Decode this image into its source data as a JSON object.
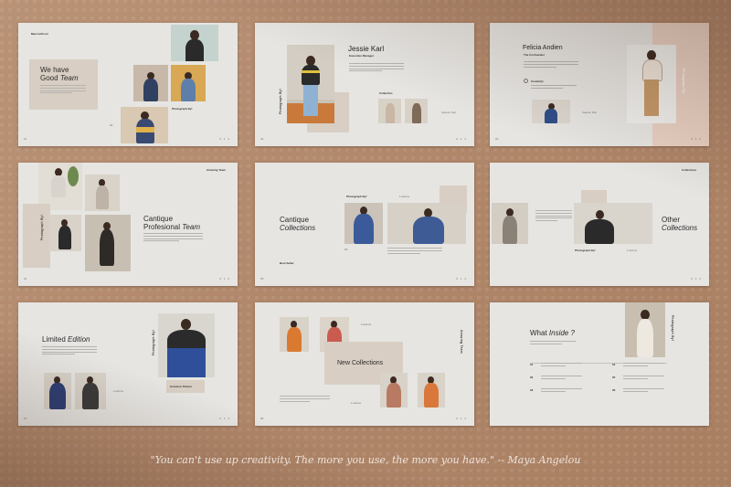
{
  "quote": "\"You can't use up creativity. The more you use, the more you have.\" -- Maya Angelou",
  "slides": {
    "s1": {
      "tag": "Meet with us!",
      "title_a": "We have",
      "title_b": "Good",
      "title_c": "Team",
      "caption": "Photograph By!",
      "num": "01",
      "page": "0 1 2"
    },
    "s2": {
      "name": "Jessie Karl",
      "role": "Executive Manager",
      "side": "Photograph By!",
      "sub": "Collection",
      "small": "Jessie Kal",
      "num": "02",
      "page": "0 1 2"
    },
    "s3": {
      "name": "Felicia Andien",
      "role": "The Cocfounder",
      "item": "Creativity",
      "side": "Photograph By!",
      "small": "Jessie Kal",
      "num": "03",
      "page": "0 1 2"
    },
    "s4": {
      "tag": "Amazing Team",
      "side": "Photograph By!",
      "title_a": "Cantique",
      "title_b": "Profesional",
      "title_c": "Team",
      "num": "04",
      "page": "0 1 2"
    },
    "s5": {
      "title_a": "Cantique",
      "title_b": "Collections",
      "caption": "Photograph By!",
      "small": "Lumina",
      "best": "Best-Seller",
      "num": "05",
      "page": "0 1 2"
    },
    "s6": {
      "tag": "Collections",
      "title_a": "Other",
      "title_b": "Collections",
      "caption": "Photograph By!",
      "small": "Lumina",
      "page": "0 1 2"
    },
    "s7": {
      "title_a": "Limited",
      "title_b": "Edition",
      "side": "Photograph By!",
      "button": "Cetomon Picture",
      "small": "Lumina",
      "num": "07",
      "page": "0 1 2"
    },
    "s8": {
      "title": "New Collections",
      "side": "Amazing Team",
      "small": "Lumina",
      "num": "08",
      "page": "0 1 2"
    },
    "s9": {
      "title_a": "What",
      "title_b": "Inside ?",
      "side": "Photograph By!",
      "items": [
        "01",
        "02",
        "03",
        "04",
        "05",
        "06"
      ]
    }
  }
}
